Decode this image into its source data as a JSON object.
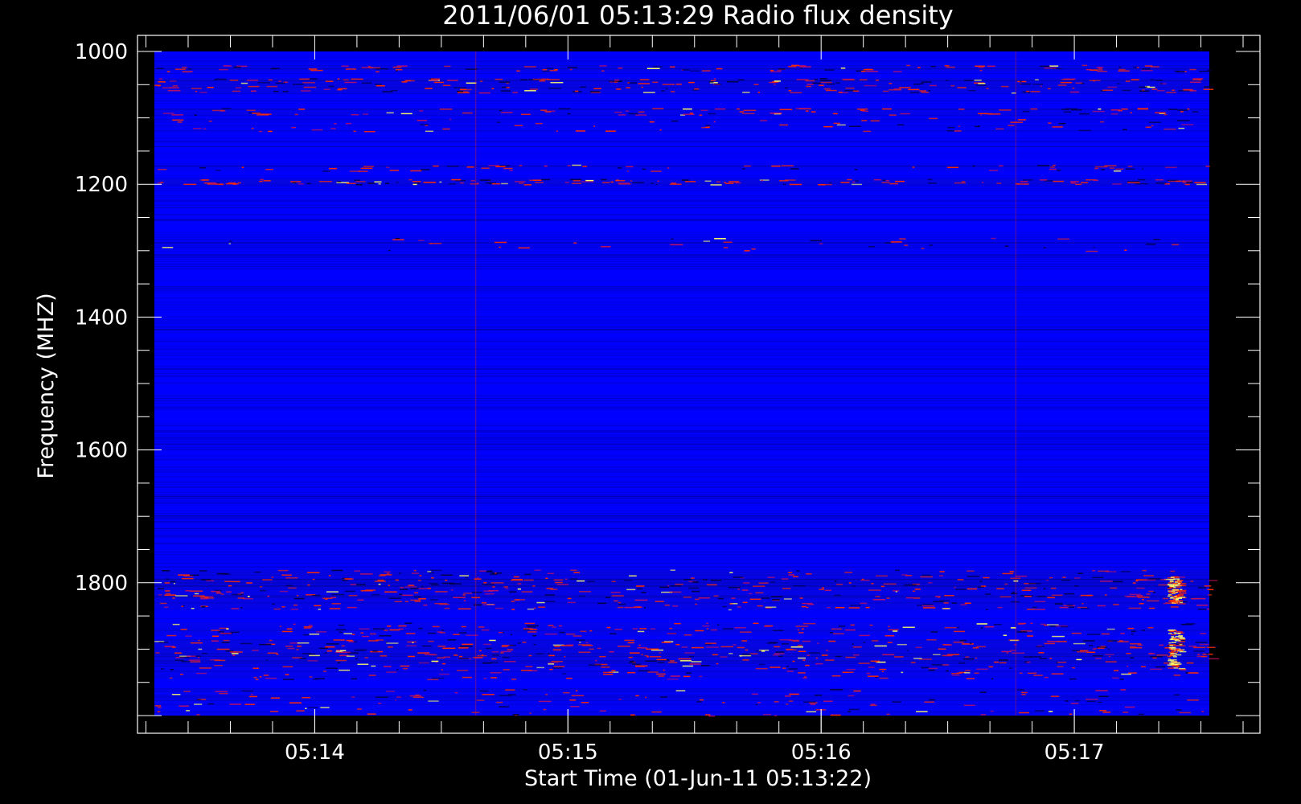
{
  "chart_data": {
    "type": "heatmap",
    "title": "2011/06/01 05:13:29 Radio flux density",
    "xlabel": "Start Time (01-Jun-11 05:13:22)",
    "ylabel": "Frequency (MHZ)",
    "x_ticks": [
      {
        "label": "05:14",
        "value": 38
      },
      {
        "label": "05:15",
        "value": 98
      },
      {
        "label": "05:16",
        "value": 158
      },
      {
        "label": "05:17",
        "value": 218
      }
    ],
    "xlim": [
      -4,
      262
    ],
    "y_ticks": [
      1000,
      1200,
      1400,
      1600,
      1800
    ],
    "ylim": [
      1000,
      2000
    ],
    "y_reversed": true,
    "data_extent_x": [
      0,
      250
    ],
    "data_extent_y": [
      1000,
      2000
    ],
    "colors": {
      "background": "#000000",
      "low": "#0000ff",
      "mid": "#ff2a00",
      "high": "#ffff66"
    },
    "series": [
      {
        "freq_start": 1020,
        "freq_end": 1030,
        "intensity": 0.55
      },
      {
        "freq_start": 1040,
        "freq_end": 1062,
        "intensity": 0.8
      },
      {
        "freq_start": 1085,
        "freq_end": 1095,
        "intensity": 0.5
      },
      {
        "freq_start": 1100,
        "freq_end": 1120,
        "intensity": 0.25
      },
      {
        "freq_start": 1170,
        "freq_end": 1180,
        "intensity": 0.35
      },
      {
        "freq_start": 1192,
        "freq_end": 1200,
        "intensity": 0.9
      },
      {
        "freq_start": 1280,
        "freq_end": 1300,
        "intensity": 0.15
      },
      {
        "freq_start": 1780,
        "freq_end": 1840,
        "intensity": 0.75
      },
      {
        "freq_start": 1860,
        "freq_end": 1880,
        "intensity": 0.55
      },
      {
        "freq_start": 1885,
        "freq_end": 1920,
        "intensity": 0.85
      },
      {
        "freq_start": 1920,
        "freq_end": 1945,
        "intensity": 0.45
      },
      {
        "freq_start": 1960,
        "freq_end": 2000,
        "intensity": 0.3
      }
    ]
  }
}
